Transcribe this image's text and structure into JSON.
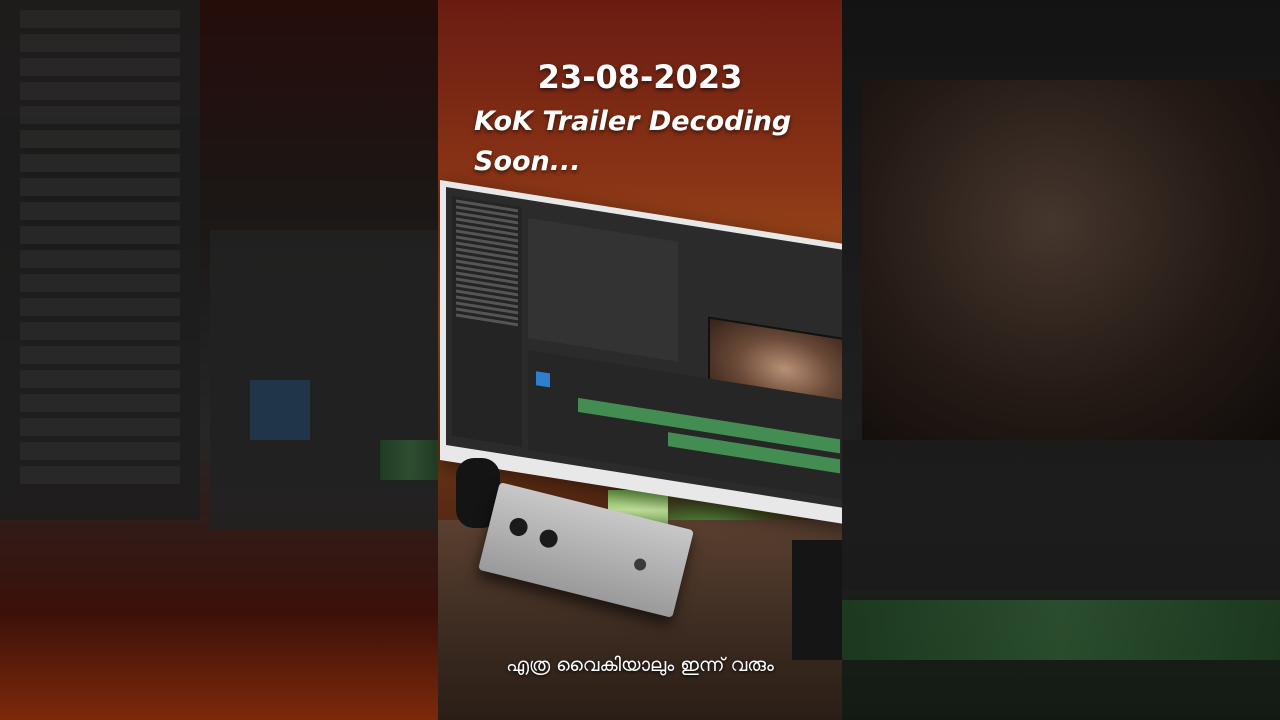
{
  "overlay": {
    "date": "23-08-2023",
    "headline": "KoK Trailer Decoding Soon...",
    "subtitle": "എത്ര വൈകിയാലും ഇന്ന് വരും"
  },
  "colors": {
    "background_warm": "#8a3416",
    "desk_glow": "#50dc5a",
    "text": "#ffffff"
  }
}
